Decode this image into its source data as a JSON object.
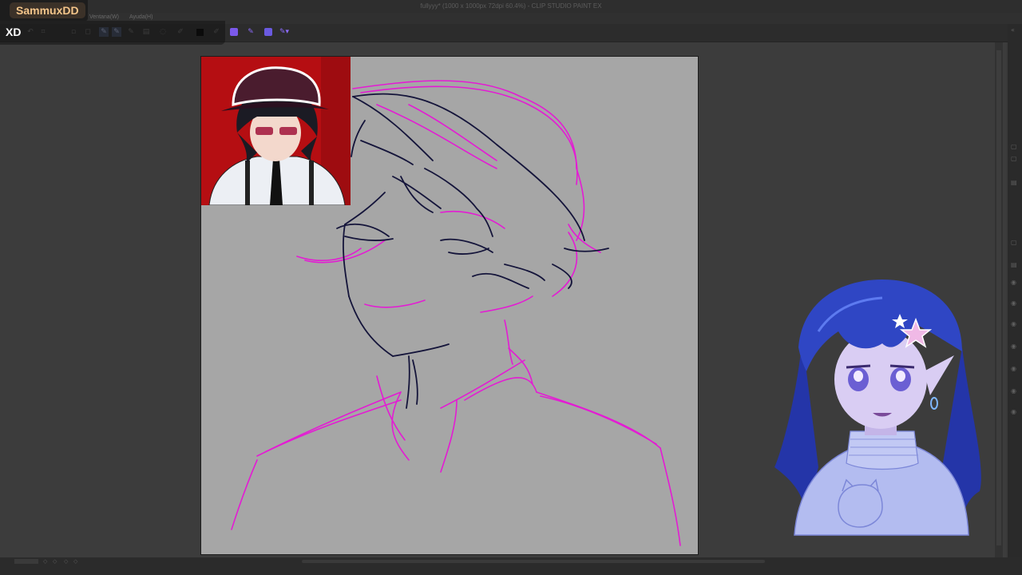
{
  "app": {
    "title": "fullyyy* (1000 x 1000px 72dpi 60.4%) - CLIP STUDIO PAINT EX"
  },
  "menu": {
    "items": [
      "Ventana(W)",
      "Ayuda(H)"
    ]
  },
  "overlay": {
    "streamer_name": "SammuxDD",
    "xd_label": "XD"
  },
  "toolbar": {
    "icons": [
      "undo-icon",
      "redo-icon",
      "transform-icon",
      "pen-icon",
      "pen-icon",
      "pencil-icon",
      "layer-icon",
      "lasso-icon",
      "pen-icon",
      "color-swatch-icon",
      "eyedropper-icon",
      "tool-icon",
      "pen-icon",
      "palette-icon",
      "pen-dropdown-icon"
    ]
  },
  "colors": {
    "canvas_bg": "#a6a6a6",
    "sketch_magenta": "#e41bd4",
    "sketch_navy": "#14143a",
    "ref_bg": "#b50e12",
    "streamer_name_color": "#f4c58a",
    "vtuber_hair": "#2f46c4"
  },
  "status": {
    "icons": [
      "grid-icon",
      "zoom-out-icon",
      "zoom-in-icon",
      "rotate-icon"
    ]
  }
}
